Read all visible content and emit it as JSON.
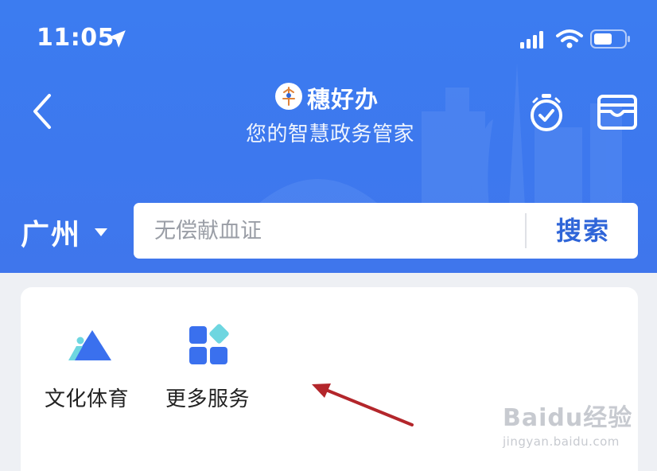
{
  "status_bar": {
    "time": "11:05"
  },
  "header": {
    "app_name": "穗好办",
    "subtitle": "您的智慧政务管家",
    "logo_text": "穗好办"
  },
  "search": {
    "city": "广州",
    "placeholder": "无偿献血证",
    "button_label": "搜索"
  },
  "services": [
    {
      "label": "文化体育",
      "icon": "triangle-culture-icon"
    },
    {
      "label": "更多服务",
      "icon": "grid-more-icon"
    }
  ],
  "colors": {
    "header_blue": "#3d78ee",
    "accent_blue": "#2f65d8",
    "annotation_red": "#b3262b"
  },
  "watermark": {
    "brand": "Baidu经验",
    "url": "jingyan.baidu.com"
  }
}
